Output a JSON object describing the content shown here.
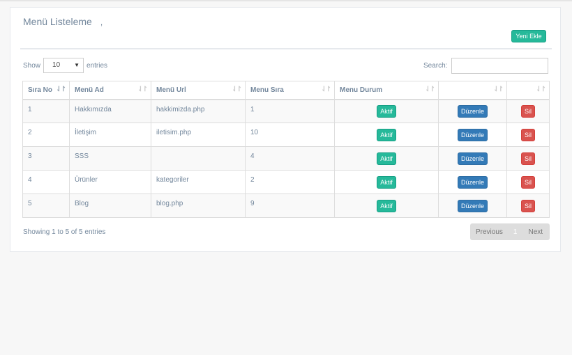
{
  "panel": {
    "title": "Menü Listeleme",
    "title_suffix": ",",
    "add_button": "Yeni Ekle"
  },
  "controls": {
    "show_label": "Show",
    "page_size": "10",
    "entries_label": "entries",
    "search_label": "Search:",
    "search_value": ""
  },
  "table": {
    "headers": [
      "Sıra No",
      "Menü Ad",
      "Menü Url",
      "Menu Sıra",
      "Menu Durum",
      "",
      ""
    ],
    "rows": [
      {
        "no": "1",
        "name": "Hakkımızda",
        "url": "hakkimizda.php",
        "order": "1",
        "status": "Aktif",
        "edit": "Düzenle",
        "delete": "Sil"
      },
      {
        "no": "2",
        "name": "İletişim",
        "url": "iletisim.php",
        "order": "10",
        "status": "Aktif",
        "edit": "Düzenle",
        "delete": "Sil"
      },
      {
        "no": "3",
        "name": "SSS",
        "url": "",
        "order": "4",
        "status": "Aktif",
        "edit": "Düzenle",
        "delete": "Sil"
      },
      {
        "no": "4",
        "name": "Ürünler",
        "url": "kategoriler",
        "order": "2",
        "status": "Aktif",
        "edit": "Düzenle",
        "delete": "Sil"
      },
      {
        "no": "5",
        "name": "Blog",
        "url": "blog.php",
        "order": "9",
        "status": "Aktif",
        "edit": "Düzenle",
        "delete": "Sil"
      }
    ]
  },
  "footer": {
    "info": "Showing 1 to 5 of 5 entries",
    "previous": "Previous",
    "page": "1",
    "next": "Next"
  },
  "colors": {
    "success": "#26b99a",
    "primary": "#337ab7",
    "danger": "#d9534f",
    "text": "#73879c"
  },
  "icons": {
    "sort": "sort-arrows-icon",
    "dropdown": "caret-down-icon"
  }
}
